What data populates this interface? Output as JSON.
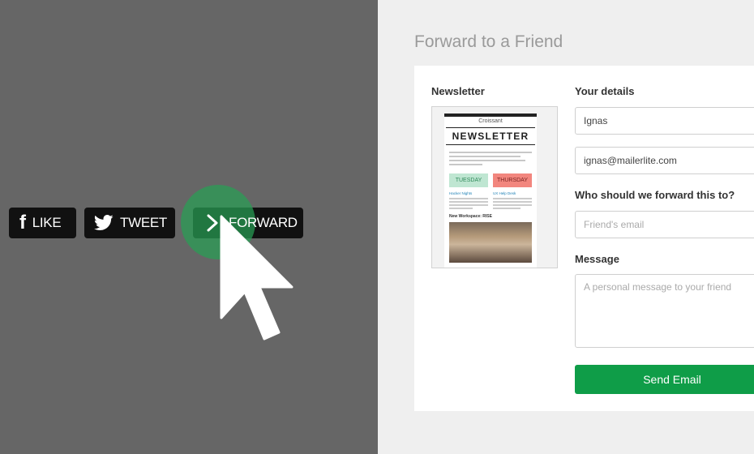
{
  "share": {
    "like_label": "LIKE",
    "tweet_label": "TWEET",
    "forward_label": "FORWARD"
  },
  "form": {
    "title": "Forward to a Friend",
    "newsletter_heading": "Newsletter",
    "your_details_heading": "Your details",
    "name_value": "Ignas",
    "email_value": "ignas@mailerlite.com",
    "forward_to_heading": "Who should we forward this to?",
    "friend_email_placeholder": "Friend's email",
    "message_heading": "Message",
    "message_placeholder": "A personal message to your friend",
    "send_label": "Send Email"
  },
  "preview": {
    "brand": "Croissant",
    "masthead": "NEWSLETTER",
    "tag_left": "TUESDAY",
    "tag_right": "THURSDAY",
    "item_left_title": "Hacker Nights",
    "item_right_title": "UX Help Desk",
    "section_title": "New Workspace: RISE"
  },
  "colors": {
    "left_bg": "#666666",
    "right_bg": "#efefef",
    "button_bg": "#111111",
    "accent_green": "#0f9d48",
    "halo_green": "#28a055"
  },
  "icons": {
    "like": "facebook-f-icon",
    "tweet": "twitter-bird-icon",
    "forward": "chevron-right-icon",
    "cursor": "mouse-pointer-icon"
  }
}
